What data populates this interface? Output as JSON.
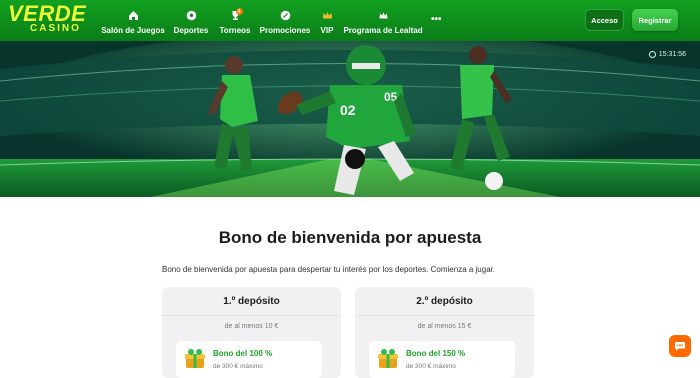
{
  "brand": {
    "logo_top": "VERDE",
    "logo_bottom": "CASINO",
    "accent": "#e8ff3a",
    "primary": "#12a01f"
  },
  "nav": [
    {
      "label": "Salón de Juegos",
      "icon": "home-icon"
    },
    {
      "label": "Deportes",
      "icon": "soccer-ball-icon"
    },
    {
      "label": "Torneos",
      "icon": "trophy-icon",
      "badge": "4"
    },
    {
      "label": "Promociones",
      "icon": "promo-icon"
    },
    {
      "label": "VIP",
      "icon": "crown-icon"
    },
    {
      "label": "Programa de Lealtad",
      "icon": "loyalty-crown-icon"
    }
  ],
  "more": "•••",
  "auth": {
    "login_label": "Acceso",
    "register_label": "Registrar"
  },
  "hero": {
    "time": "15:31:56"
  },
  "main": {
    "title": "Bono de bienvenida por apuesta",
    "description": "Bono de bienvenida por apuesta para despertar tu interés por los deportes. Comienza a jugar."
  },
  "cards": [
    {
      "title": "1.º depósito",
      "minimum": "de al menos 10 €",
      "bonus": "Bono del 100 %",
      "max": "de 300 € máximo"
    },
    {
      "title": "2.º depósito",
      "minimum": "de al menos 15 €",
      "bonus": "Bono del 150 %",
      "max": "de 300 € máximo"
    }
  ]
}
